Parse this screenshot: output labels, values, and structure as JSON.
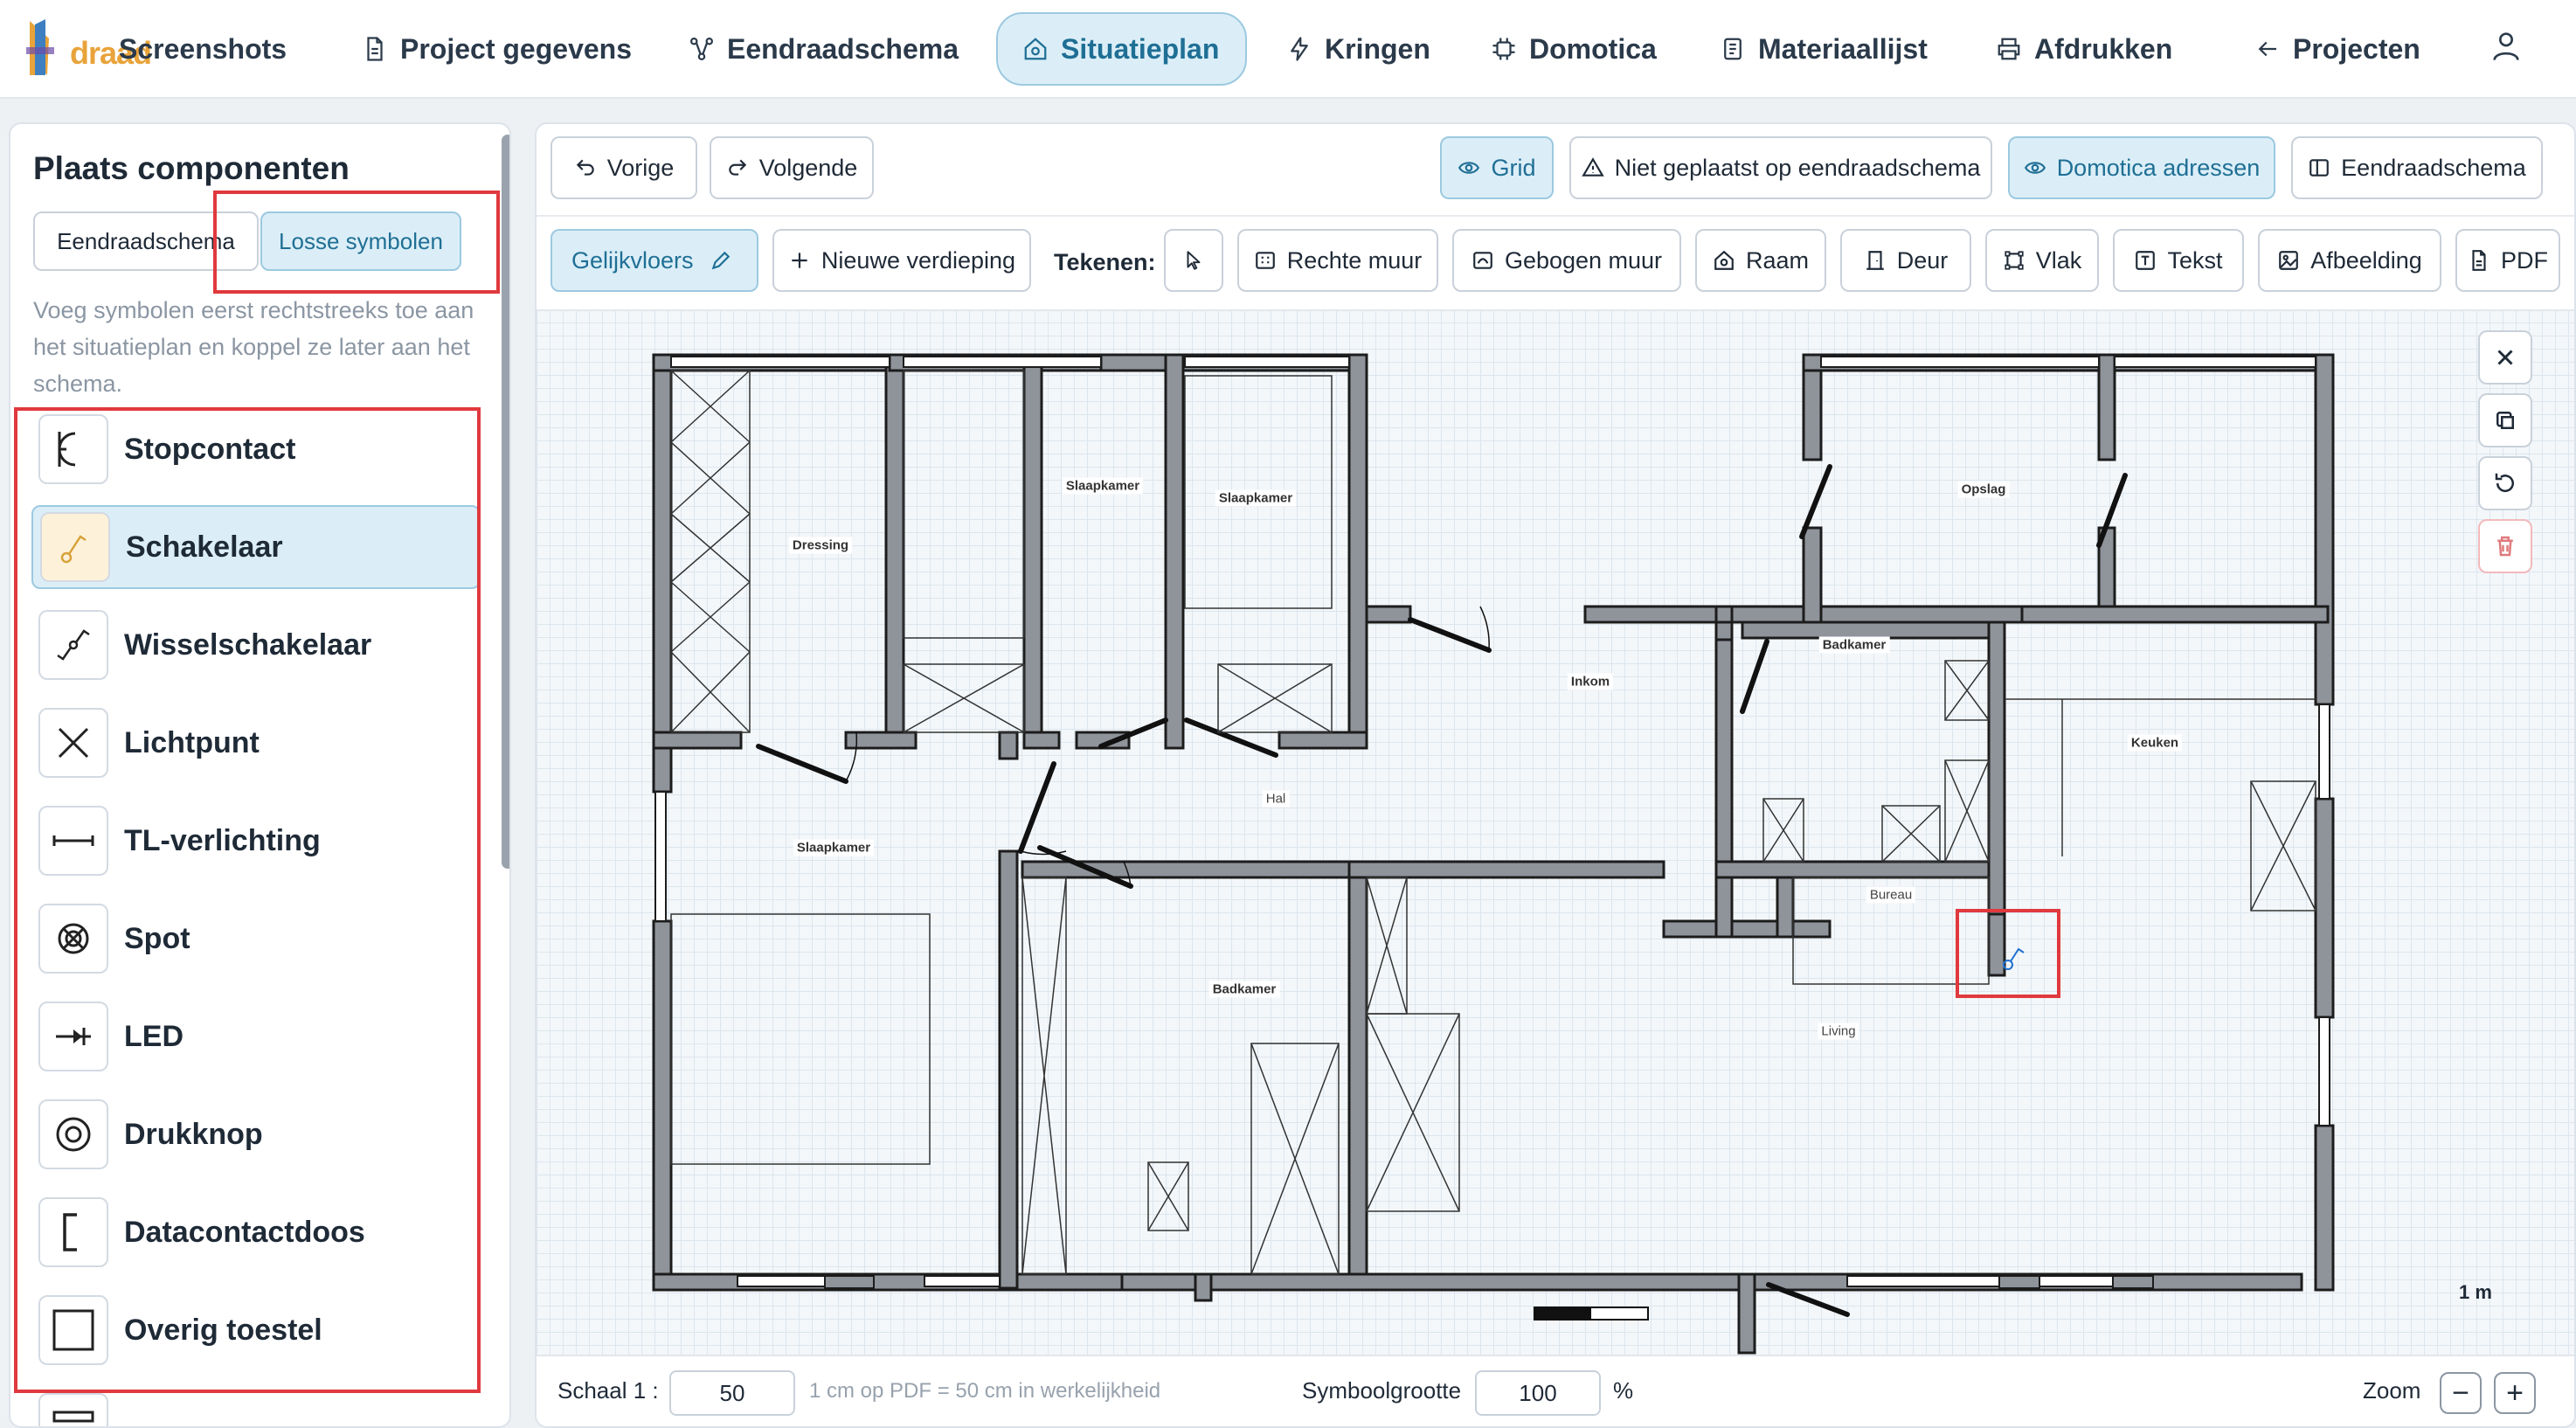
{
  "nav": {
    "brand_suffix": "draad",
    "items": [
      {
        "id": "screenshots",
        "label": "Screenshots"
      },
      {
        "id": "project",
        "label": "Project gegevens"
      },
      {
        "id": "eendraad",
        "label": "Eendraadschema"
      },
      {
        "id": "situatieplan",
        "label": "Situatieplan"
      },
      {
        "id": "kringen",
        "label": "Kringen"
      },
      {
        "id": "domotica",
        "label": "Domotica"
      },
      {
        "id": "materiaal",
        "label": "Materiaallijst"
      },
      {
        "id": "afdrukken",
        "label": "Afdrukken"
      },
      {
        "id": "projecten",
        "label": "Projecten"
      }
    ],
    "active": "Situatieplan"
  },
  "left": {
    "title": "Plaats componenten",
    "mode_tabs": [
      "Eendraadschema",
      "Losse symbolen"
    ],
    "selected_tab": "Losse symbolen",
    "hint": "Voeg symbolen eerst rechtstreeks toe aan het situatieplan en koppel ze later aan het schema.",
    "symbols": [
      {
        "label": "Stopcontact",
        "icon": "socket-icon"
      },
      {
        "label": "Schakelaar",
        "icon": "switch-icon",
        "selected": true
      },
      {
        "label": "Wisselschakelaar",
        "icon": "two-way-switch-icon"
      },
      {
        "label": "Lichtpunt",
        "icon": "light-point-icon"
      },
      {
        "label": "TL-verlichting",
        "icon": "fluorescent-light-icon"
      },
      {
        "label": "Spot",
        "icon": "spot-icon"
      },
      {
        "label": "LED",
        "icon": "led-icon"
      },
      {
        "label": "Drukknop",
        "icon": "push-button-icon"
      },
      {
        "label": "Datacontactdoos",
        "icon": "data-socket-icon"
      },
      {
        "label": "Overig toestel",
        "icon": "other-device-icon"
      }
    ]
  },
  "toolbar": {
    "prev": "Vorige",
    "next": "Volgende",
    "grid": "Grid",
    "not_placed": "Niet geplaatst op eendraadschema",
    "domotica": "Domotica adressen",
    "eendraad": "Eendraadschema",
    "floor": "Gelijkvloers",
    "new_floor": "Nieuwe verdieping",
    "draw_label": "Tekenen:",
    "tools": [
      "Rechte muur",
      "Gebogen muur",
      "Raam",
      "Deur",
      "Vlak",
      "Tekst",
      "Afbeelding",
      "PDF"
    ]
  },
  "rooms": [
    "Dressing",
    "Slaapkamer",
    "Slaapkamer",
    "Opslag",
    "Inkom",
    "Badkamer",
    "Keuken",
    "Hal",
    "Slaapkamer",
    "Bureau",
    "Badkamer",
    "Living"
  ],
  "scale_bar": "1 m",
  "bottom": {
    "scale_label": "Schaal 1 :",
    "scale_value": "50",
    "scale_hint": "1 cm op PDF = 50 cm in werkelijkheid",
    "symbol_size_label": "Symboolgrootte",
    "symbol_size_value": "100",
    "percent": "%",
    "zoom_label": "Zoom",
    "zoom_out": "−",
    "zoom_in": "+"
  },
  "colors": {
    "accent": "#1f6f95",
    "accent_bg": "#dbeef7",
    "highlight": "#e0393e",
    "wall": "#8f949b"
  }
}
